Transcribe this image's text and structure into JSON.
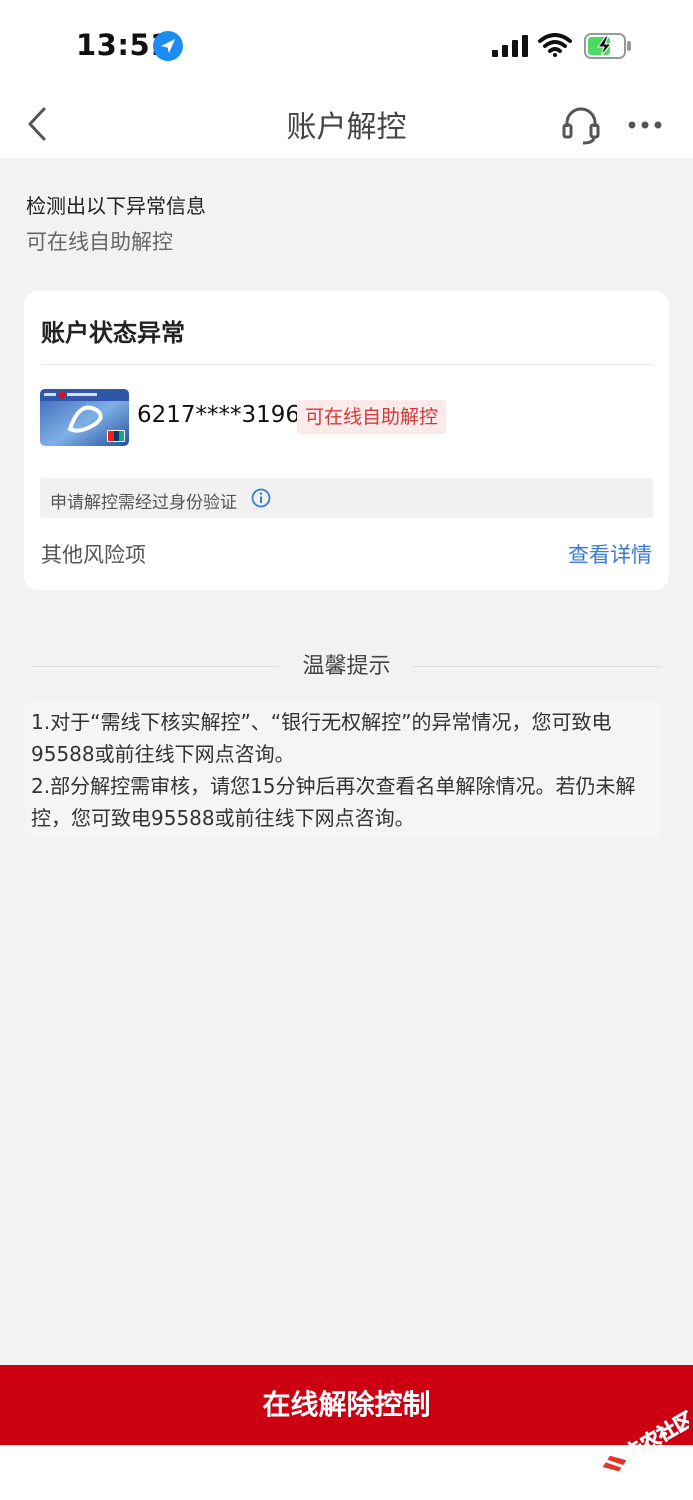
{
  "status_bar": {
    "time": "13:51",
    "icons": [
      "location-arrow-icon",
      "cellular-signal-icon",
      "wifi-icon",
      "battery-charging-icon"
    ],
    "battery_color": "#4cd964",
    "location_color": "#1d8cf0"
  },
  "nav": {
    "title": "账户解控",
    "back_icon": "chevron-left-icon",
    "support_icon": "headset-icon",
    "more_icon": "more-dots-icon"
  },
  "intro": {
    "line1": "检测出以下异常信息",
    "line2": "可在线自助解控"
  },
  "card": {
    "title": "账户状态异常",
    "bank_card_image": "icbc-card-icon",
    "card_number": "6217****3196",
    "status_tag": "可在线自助解控",
    "notice": "申请解控需经过身份验证",
    "notice_icon": "info-circle-icon",
    "other_risk": "其他风险项",
    "view_details": "查看详情"
  },
  "tips": {
    "title": "温馨提示",
    "text": "1.对于“需线下核实解控”、“银行无权解控”的异常情况，您可致电95588或前往线下网点咨询。\n2.部分解控需审核，请您15分钟后再次查看名单解除情况。若仍未解控，您可致电95588或前往线下网点咨询。"
  },
  "action": {
    "button_label": "在线解除控制"
  },
  "watermark": {
    "text": "卡农社区"
  },
  "colors": {
    "accent_red": "#cc0011",
    "link_blue": "#3a7bd5",
    "tag_red": "#d23a3a"
  }
}
